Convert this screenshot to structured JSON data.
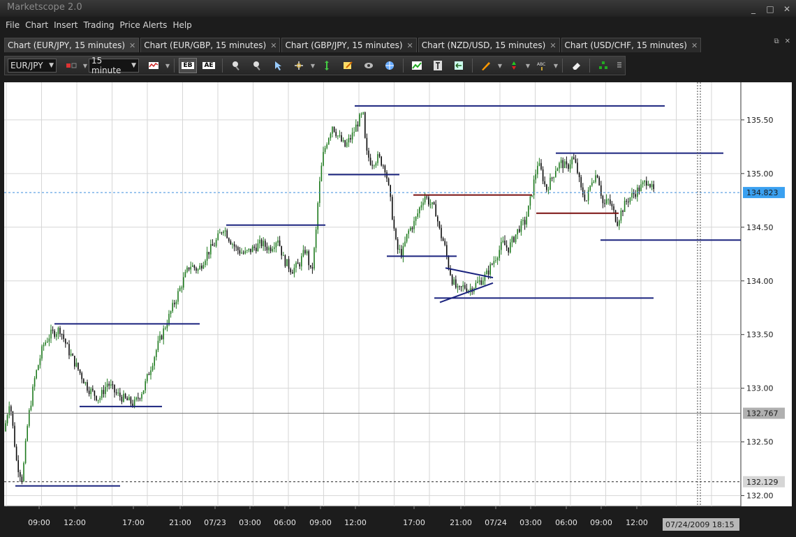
{
  "window": {
    "title": "Marketscope 2.0",
    "controls": [
      "_",
      "□",
      "✕"
    ]
  },
  "menu": [
    "File",
    "Chart",
    "Insert",
    "Trading",
    "Price Alerts",
    "Help"
  ],
  "tabs": [
    {
      "label": "Chart (EUR/JPY, 15 minutes)",
      "active": true
    },
    {
      "label": "Chart (EUR/GBP, 15 minutes)",
      "active": false
    },
    {
      "label": "Chart (GBP/JPY, 15 minutes)",
      "active": false
    },
    {
      "label": "Chart (NZD/USD, 15 minutes)",
      "active": false
    },
    {
      "label": "Chart (USD/CHF, 15 minutes)",
      "active": false
    }
  ],
  "toolbar": {
    "instrument": "EUR/JPY",
    "timeframe": "15 minutes",
    "timeframe_visible": "15 minute",
    "tools": [
      "chart-type-icon",
      "bid-icon",
      "ask-icon",
      "zoom-in-icon",
      "zoom-out-icon",
      "cursor-icon",
      "crosshair-icon",
      "fit-icon",
      "edit-icon",
      "eye-icon",
      "globe-icon",
      "indicator-icon",
      "text-cursor-icon",
      "import-icon",
      "pencil-icon",
      "marker-icon",
      "text-tool-icon",
      "eraser-icon",
      "pyramid-icon",
      "more-icon"
    ],
    "pressed_labels": [
      "EB",
      "AE"
    ]
  },
  "chart_data": {
    "type": "candlestick",
    "symbol": "EUR/JPY",
    "timeframe": "15 minutes",
    "ylim": [
      131.9,
      135.85
    ],
    "y_ticks": [
      "132.00",
      "132.50",
      "133.00",
      "133.50",
      "134.00",
      "134.50",
      "135.00",
      "135.50"
    ],
    "x_ticks": [
      "09:00",
      "12:00",
      "17:00",
      "21:00",
      "07/23",
      "03:00",
      "06:00",
      "09:00",
      "12:00",
      "17:00",
      "21:00",
      "07/24",
      "03:00",
      "06:00",
      "09:00",
      "12:00"
    ],
    "current_price": "134.823",
    "crosshair_price": "132.767",
    "level_price": "132.129",
    "crosshair_time": "07/24/2009 18:15",
    "price_path": [
      [
        0,
        132.6
      ],
      [
        8,
        132.9
      ],
      [
        18,
        132.3
      ],
      [
        26,
        132.15
      ],
      [
        34,
        132.7
      ],
      [
        44,
        133.1
      ],
      [
        56,
        133.4
      ],
      [
        66,
        133.5
      ],
      [
        80,
        133.55
      ],
      [
        92,
        133.35
      ],
      [
        104,
        133.2
      ],
      [
        120,
        133.0
      ],
      [
        136,
        132.9
      ],
      [
        148,
        133.05
      ],
      [
        160,
        132.95
      ],
      [
        172,
        132.9
      ],
      [
        186,
        132.85
      ],
      [
        200,
        133.0
      ],
      [
        210,
        133.2
      ],
      [
        220,
        133.4
      ],
      [
        232,
        133.6
      ],
      [
        244,
        133.8
      ],
      [
        256,
        134.0
      ],
      [
        266,
        134.15
      ],
      [
        278,
        134.1
      ],
      [
        290,
        134.25
      ],
      [
        302,
        134.35
      ],
      [
        314,
        134.5
      ],
      [
        322,
        134.4
      ],
      [
        332,
        134.3
      ],
      [
        344,
        134.25
      ],
      [
        356,
        134.3
      ],
      [
        368,
        134.35
      ],
      [
        380,
        134.3
      ],
      [
        392,
        134.4
      ],
      [
        400,
        134.2
      ],
      [
        412,
        134.1
      ],
      [
        422,
        134.15
      ],
      [
        432,
        134.3
      ],
      [
        440,
        134.05
      ],
      [
        446,
        134.4
      ],
      [
        450,
        134.8
      ],
      [
        456,
        135.15
      ],
      [
        462,
        135.3
      ],
      [
        470,
        135.45
      ],
      [
        478,
        135.35
      ],
      [
        488,
        135.25
      ],
      [
        498,
        135.35
      ],
      [
        508,
        135.5
      ],
      [
        514,
        135.55
      ],
      [
        518,
        135.2
      ],
      [
        526,
        135.1
      ],
      [
        536,
        135.15
      ],
      [
        546,
        135.05
      ],
      [
        552,
        134.8
      ],
      [
        558,
        134.5
      ],
      [
        562,
        134.3
      ],
      [
        570,
        134.25
      ],
      [
        578,
        134.45
      ],
      [
        588,
        134.55
      ],
      [
        596,
        134.7
      ],
      [
        602,
        134.8
      ],
      [
        610,
        134.72
      ],
      [
        618,
        134.65
      ],
      [
        624,
        134.45
      ],
      [
        630,
        134.35
      ],
      [
        636,
        134.15
      ],
      [
        642,
        134.0
      ],
      [
        650,
        133.9
      ],
      [
        658,
        133.95
      ],
      [
        666,
        133.92
      ],
      [
        674,
        133.96
      ],
      [
        682,
        134.0
      ],
      [
        690,
        134.05
      ],
      [
        698,
        134.15
      ],
      [
        706,
        134.25
      ],
      [
        714,
        134.35
      ],
      [
        722,
        134.3
      ],
      [
        730,
        134.4
      ],
      [
        738,
        134.5
      ],
      [
        746,
        134.55
      ],
      [
        752,
        134.7
      ],
      [
        758,
        134.9
      ],
      [
        764,
        135.1
      ],
      [
        770,
        135.0
      ],
      [
        776,
        134.85
      ],
      [
        784,
        134.95
      ],
      [
        790,
        135.05
      ],
      [
        798,
        135.1
      ],
      [
        806,
        135.05
      ],
      [
        814,
        135.15
      ],
      [
        820,
        135.05
      ],
      [
        826,
        134.85
      ],
      [
        834,
        134.75
      ],
      [
        842,
        134.95
      ],
      [
        850,
        135.0
      ],
      [
        858,
        134.7
      ],
      [
        866,
        134.75
      ],
      [
        872,
        134.65
      ],
      [
        878,
        134.55
      ],
      [
        884,
        134.65
      ],
      [
        892,
        134.75
      ],
      [
        900,
        134.8
      ],
      [
        908,
        134.85
      ],
      [
        916,
        134.9
      ],
      [
        922,
        134.95
      ],
      [
        928,
        134.85
      ],
      [
        932,
        134.82
      ]
    ],
    "trendlines": [
      {
        "x1": 16,
        "x2": 166,
        "y": 132.09,
        "color": "#1a237e"
      },
      {
        "x1": 72,
        "x2": 280,
        "y": 133.6,
        "color": "#1a237e"
      },
      {
        "x1": 108,
        "x2": 226,
        "y": 132.83,
        "color": "#1a237e"
      },
      {
        "x1": 318,
        "x2": 460,
        "y": 134.52,
        "color": "#1a237e"
      },
      {
        "x1": 464,
        "x2": 566,
        "y": 134.99,
        "color": "#1a237e"
      },
      {
        "x1": 502,
        "x2": 946,
        "y": 135.63,
        "color": "#1a237e"
      },
      {
        "x1": 548,
        "x2": 648,
        "y": 134.23,
        "color": "#1a237e"
      },
      {
        "x1": 586,
        "x2": 756,
        "y": 134.8,
        "color": "#7a1010"
      },
      {
        "x1": 616,
        "x2": 930,
        "y": 133.84,
        "color": "#1a237e"
      },
      {
        "x1": 790,
        "x2": 1030,
        "y": 135.19,
        "color": "#1a237e"
      },
      {
        "x1": 762,
        "x2": 880,
        "y": 134.63,
        "color": "#7a1010"
      },
      {
        "x1": 854,
        "x2": 1055,
        "y": 134.38,
        "color": "#1a237e"
      }
    ],
    "triangle": [
      {
        "x1": 632,
        "x2": 700,
        "y1": 134.12,
        "y2": 134.03,
        "color": "#1a237e"
      },
      {
        "x1": 624,
        "x2": 700,
        "y1": 133.8,
        "y2": 133.98,
        "color": "#1a237e"
      }
    ],
    "colors": {
      "up": "#1e7a1e",
      "down": "#0a0a0a",
      "grid": "#d6d6d6",
      "price_line": "#3b8ede",
      "price_badge": "#3aa0f0"
    }
  }
}
